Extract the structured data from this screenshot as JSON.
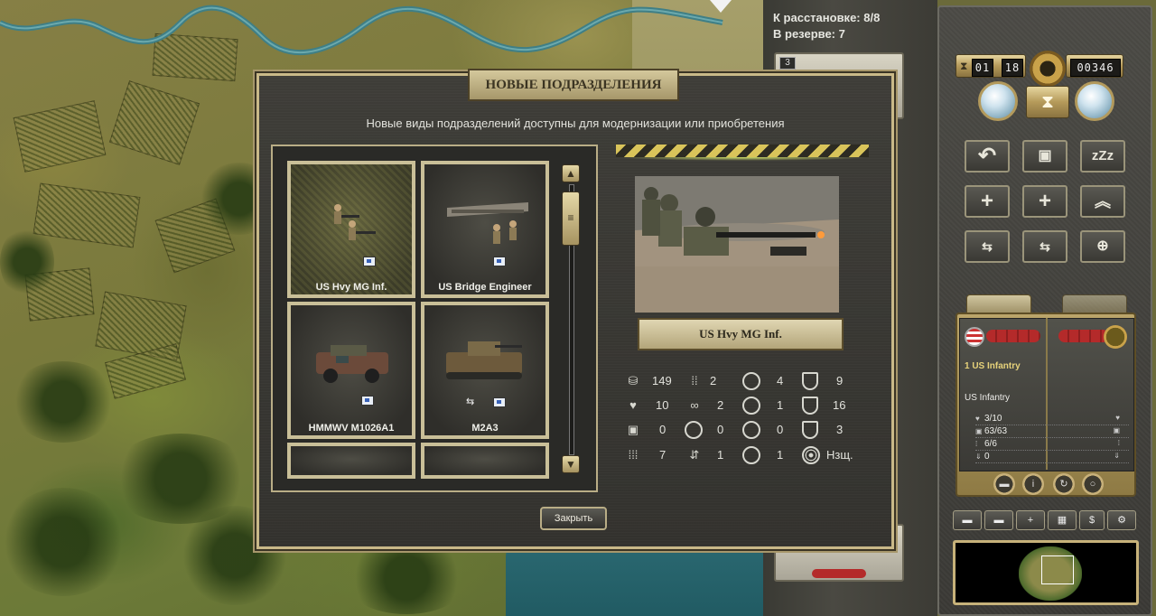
{
  "deploy": {
    "to_place": "К расстановке: 8/8",
    "in_reserve": "В резерве: 7",
    "slot_number": "3"
  },
  "counters": {
    "day": "01",
    "turn": "18",
    "prestige": "00346"
  },
  "controls": {
    "sleep_label": "zZz",
    "money_label": "$"
  },
  "unit_card": {
    "name": "1 US Infantry",
    "type": "US Infantry",
    "strength": "3/10",
    "ammo": "63/63",
    "fuel": "6/6",
    "experience": "0"
  },
  "dialog": {
    "title": "НОВЫЕ ПОДРАЗДЕЛЕНИЯ",
    "subtitle": "Новые виды подразделений доступны для модернизации или приобретения",
    "close_label": "Закрыть",
    "units": [
      {
        "name": "US Hvy MG Inf.",
        "selected": true
      },
      {
        "name": "US Bridge Engineer",
        "selected": false
      },
      {
        "name": "HMMWV M1026A1",
        "selected": false
      },
      {
        "name": "M2A3",
        "selected": false
      }
    ],
    "selected_unit": "US Hvy MG Inf.",
    "stats": {
      "cost": "149",
      "movement": "2",
      "soft_attack": "4",
      "ground_defense": "9",
      "strength": "10",
      "spotting": "2",
      "hard_attack": "1",
      "air_defense": "16",
      "fuel": "0",
      "range": "0",
      "air_attack": "0",
      "close_defense": "3",
      "ammo": "7",
      "transport": "1",
      "naval_attack": "1",
      "target_type": "Нзщ."
    }
  },
  "colors": {
    "brass": "#b59a5a",
    "dialog_bg": "#3a3935",
    "accent_text": "#e6d27a",
    "hazard_yellow": "#d9c45a"
  }
}
